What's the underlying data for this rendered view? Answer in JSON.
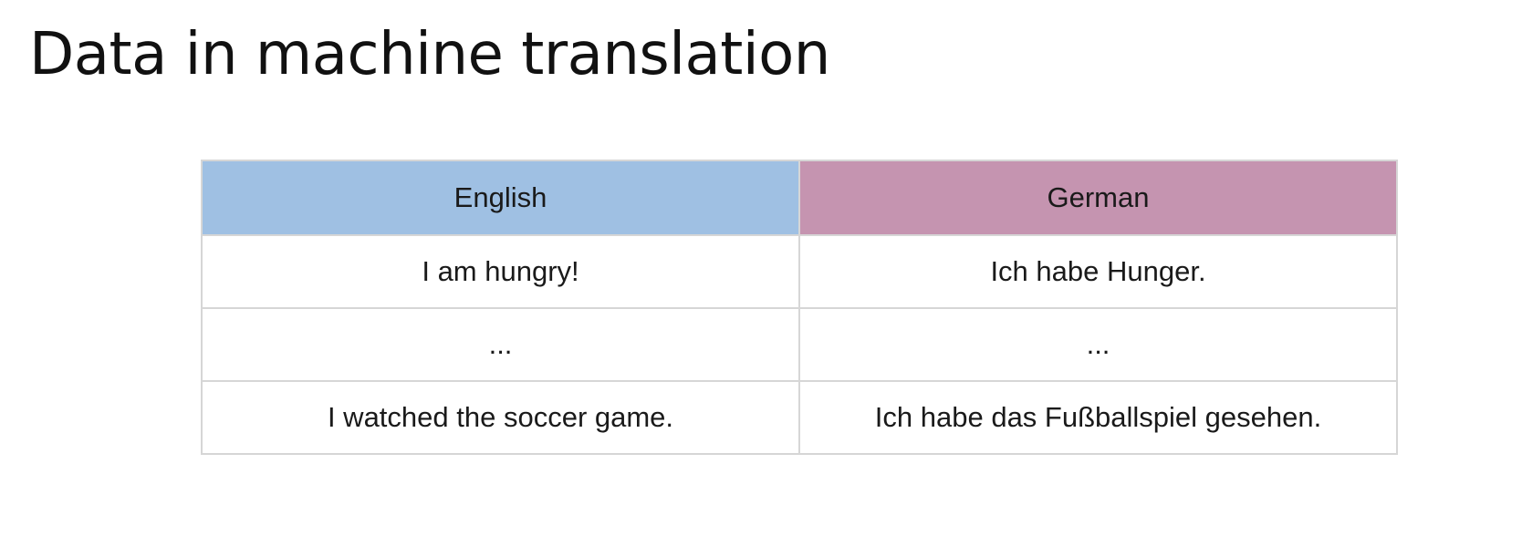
{
  "slide": {
    "title": "Data in machine translation"
  },
  "table": {
    "headers": [
      "English",
      "German"
    ],
    "header_colors": [
      "#9fc0e3",
      "#c594b0"
    ],
    "rows": [
      [
        "I am hungry!",
        "Ich habe Hunger."
      ],
      [
        "...",
        "..."
      ],
      [
        "I watched the soccer game.",
        "Ich habe das Fußballspiel gesehen."
      ]
    ]
  }
}
